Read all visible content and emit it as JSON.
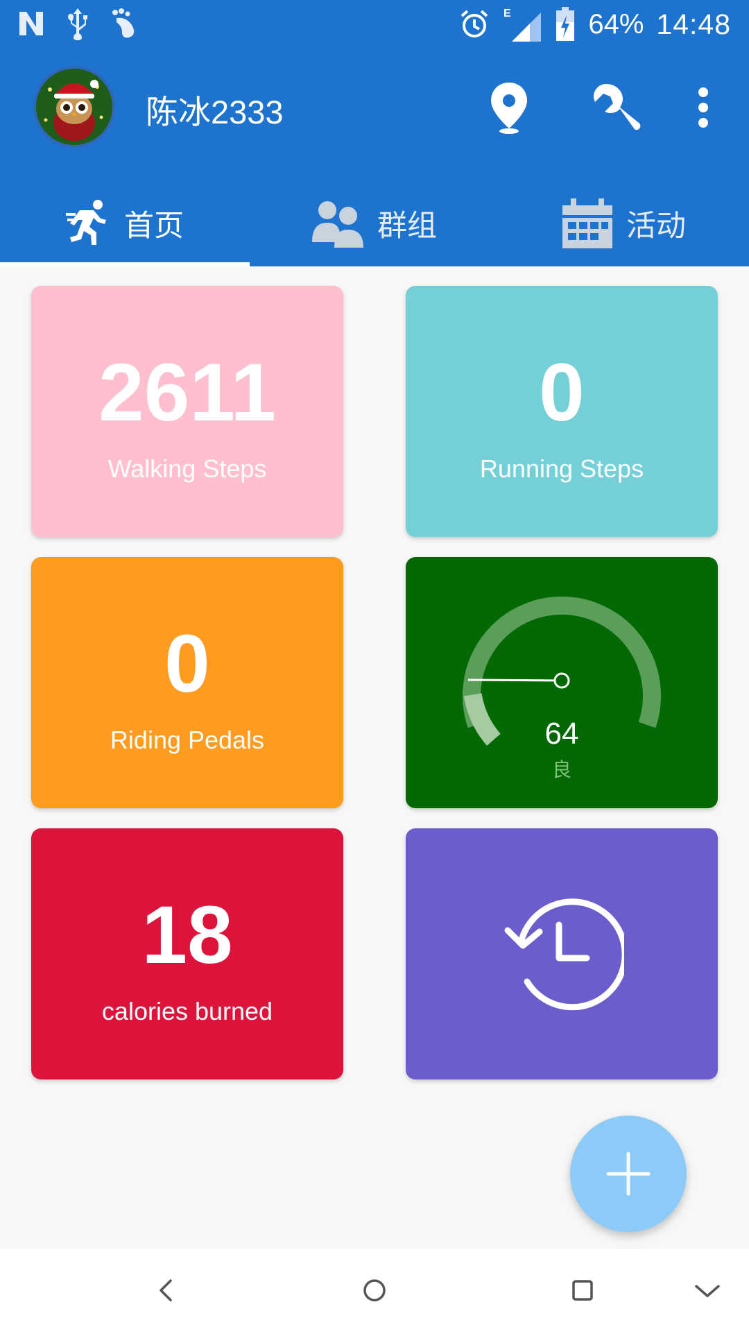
{
  "status_bar": {
    "icons_left": [
      "n-notification-icon",
      "usb-icon",
      "footprint-icon"
    ],
    "icons_right": [
      "alarm-icon",
      "signal-e-icon",
      "battery-charging-icon"
    ],
    "battery": "64%",
    "time": "14:48",
    "network": "E"
  },
  "toolbar": {
    "username": "陈冰2333",
    "actions": [
      "location-icon",
      "wrench-icon",
      "more-vert-icon"
    ]
  },
  "tabs": [
    {
      "label": "首页",
      "icon": "running-person-icon",
      "selected": true
    },
    {
      "label": "群组",
      "icon": "group-icon",
      "selected": false
    },
    {
      "label": "活动",
      "icon": "calendar-icon",
      "selected": false
    }
  ],
  "cards": {
    "walking": {
      "value": "2611",
      "caption": "Walking Steps",
      "color": "#ffbfce"
    },
    "running": {
      "value": "0",
      "caption": "Running Steps",
      "color": "#74cfd6"
    },
    "riding": {
      "value": "0",
      "caption": "Riding Pedals",
      "color": "#ff9b21"
    },
    "gauge": {
      "value": "64",
      "label": "良",
      "color": "#046904",
      "level": 64
    },
    "calories": {
      "value": "18",
      "caption": "calories burned",
      "color": "#dc143c"
    },
    "history": {
      "icon": "history-icon",
      "color": "#6b5dcc"
    }
  },
  "fab": {
    "icon": "plus-icon",
    "color": "#8ccbf8"
  },
  "navigation": [
    "back-icon",
    "home-icon",
    "recents-icon",
    "collapse-icon"
  ],
  "colors": {
    "appbar": "#1e73cf"
  }
}
